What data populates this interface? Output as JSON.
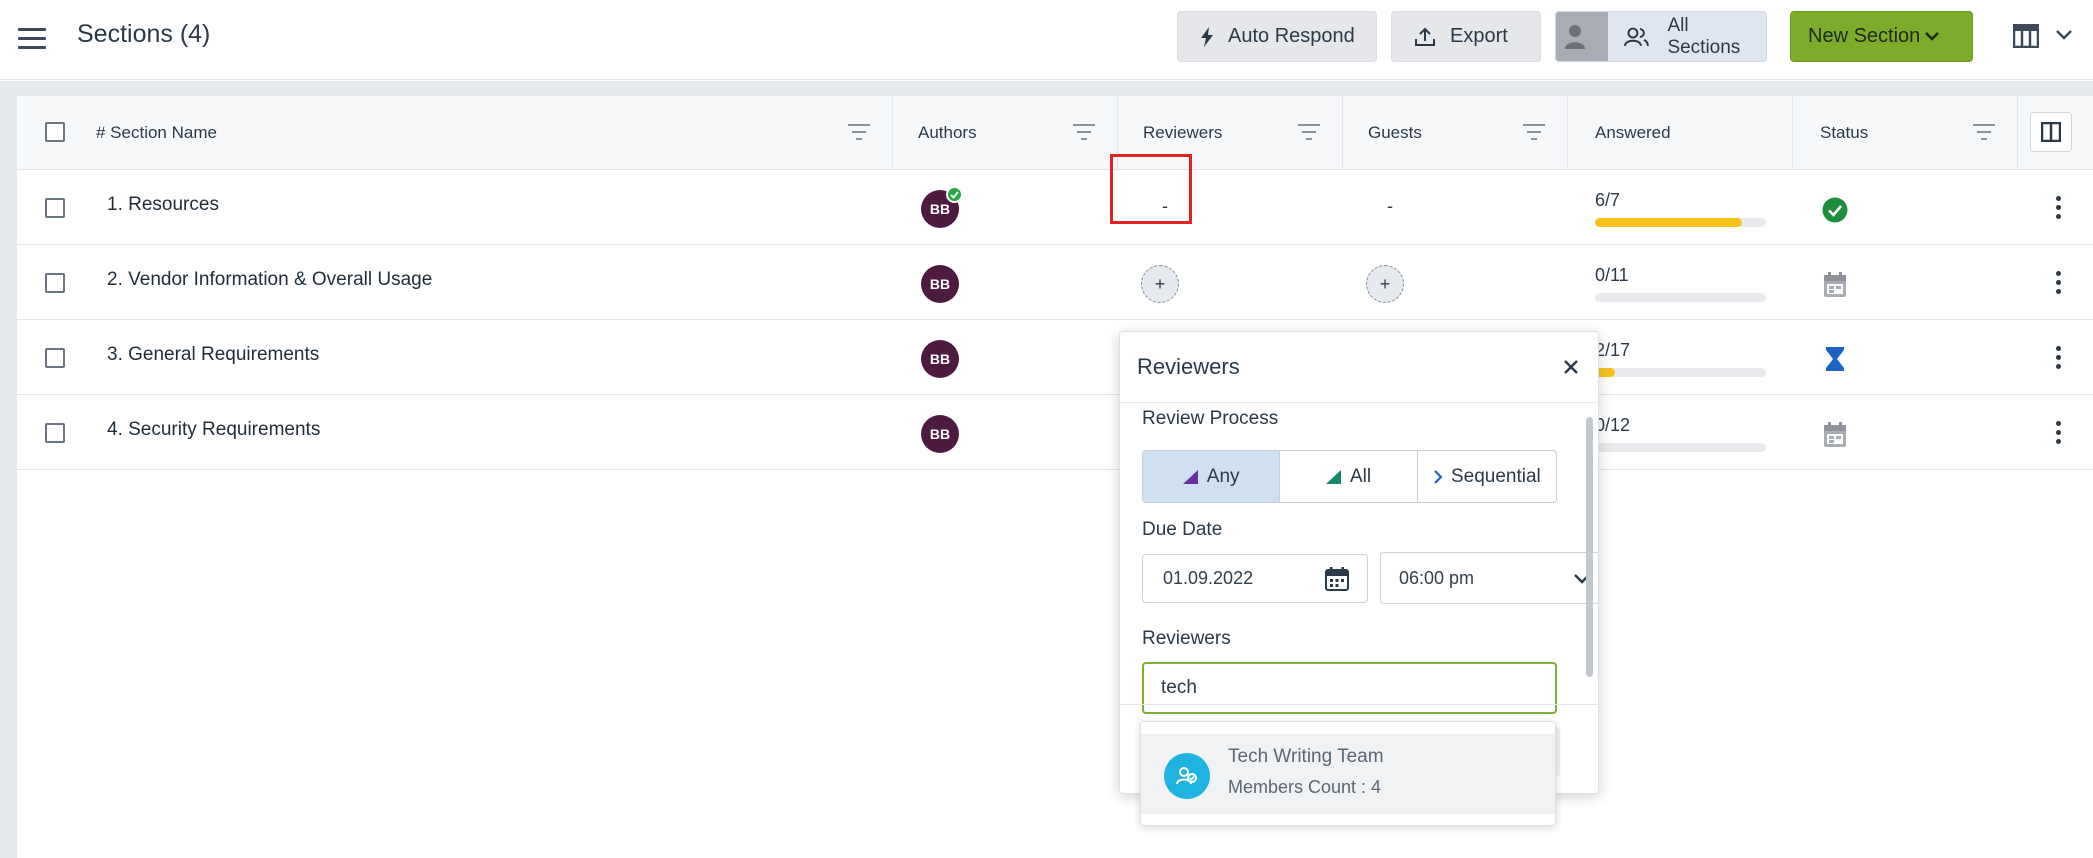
{
  "header": {
    "title": "Sections (4)",
    "buttons": {
      "auto_respond": "Auto Respond",
      "export": "Export",
      "all_sections": "All Sections",
      "new_section": "New Section"
    }
  },
  "table": {
    "columns": {
      "section_name": "# Section Name",
      "authors": "Authors",
      "reviewers": "Reviewers",
      "guests": "Guests",
      "answered": "Answered",
      "status": "Status"
    },
    "rows": [
      {
        "name": "1. Resources",
        "author": "BB",
        "reviewers": "-",
        "guests": "-",
        "answered": "6/7",
        "progress": 0.857,
        "status": "completed"
      },
      {
        "name": "2. Vendor Information & Overall Usage",
        "author": "BB",
        "reviewers": "+",
        "guests": "+",
        "answered": "0/11",
        "progress": 0,
        "status": "scheduled"
      },
      {
        "name": "3. General Requirements",
        "author": "BB",
        "answered": "2/17",
        "progress": 0.118,
        "status": "in-progress"
      },
      {
        "name": "4. Security Requirements",
        "author": "BB",
        "answered": "0/12",
        "progress": 0,
        "status": "scheduled"
      }
    ]
  },
  "popup": {
    "title": "Reviewers",
    "review_process_label": "Review Process",
    "process_options": [
      "Any",
      "All",
      "Sequential"
    ],
    "selected_process": "Any",
    "due_date_label": "Due Date",
    "due_date": "01.09.2022",
    "due_time": "06:00 pm",
    "reviewers_label": "Reviewers",
    "reviewers_input": "tech"
  },
  "suggestion": {
    "name": "Tech Writing Team",
    "members": "Members Count : 4"
  },
  "colors": {
    "accent_green": "#7dac2a",
    "avatar": "#4e1a3f",
    "progress_fill": "#f6c31c",
    "status_done": "#1e8e3e",
    "status_progress": "#1c63c4",
    "highlight": "#e32124"
  }
}
